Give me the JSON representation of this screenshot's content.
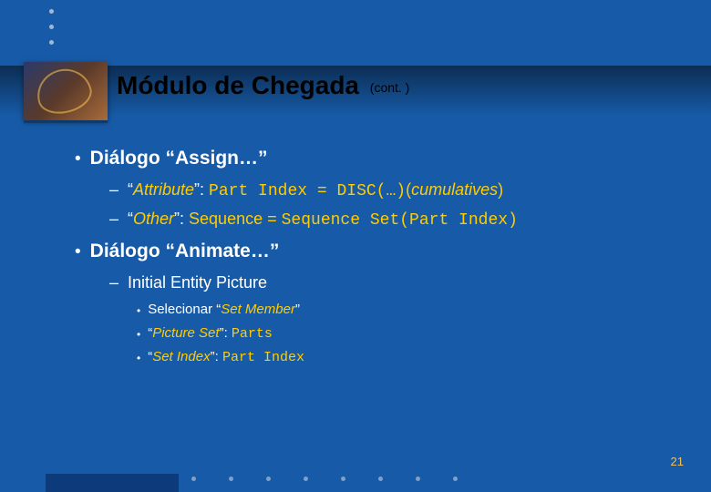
{
  "header": {
    "title": "Módulo de Chegada",
    "cont": "(cont. )"
  },
  "content": {
    "b1": "Diálogo “Assign…”",
    "b1s1": {
      "label_pre": "“",
      "label_word": "Attribute",
      "label_post": "”: ",
      "code": "Part Index = DISC(…)",
      "tail_open": "(",
      "tail_word": "cumulatives",
      "tail_close": ")"
    },
    "b1s2": {
      "label_pre": "“",
      "label_word": "Other",
      "label_post": "”: ",
      "seq_pre": "Sequence = ",
      "code": "Sequence Set(Part Index)"
    },
    "b2": "Diálogo “Animate…”",
    "b2s1": "Initial Entity Picture",
    "b2s1a": {
      "pre": "Selecionar “",
      "em": "Set Member",
      "post": "”"
    },
    "b2s1b": {
      "pre": "“",
      "em": "Picture Set",
      "post": "”: ",
      "code": "Parts"
    },
    "b2s1c": {
      "pre": "“",
      "em": "Set Index",
      "post": "”: ",
      "code": "Part Index"
    }
  },
  "slide_number": "21"
}
